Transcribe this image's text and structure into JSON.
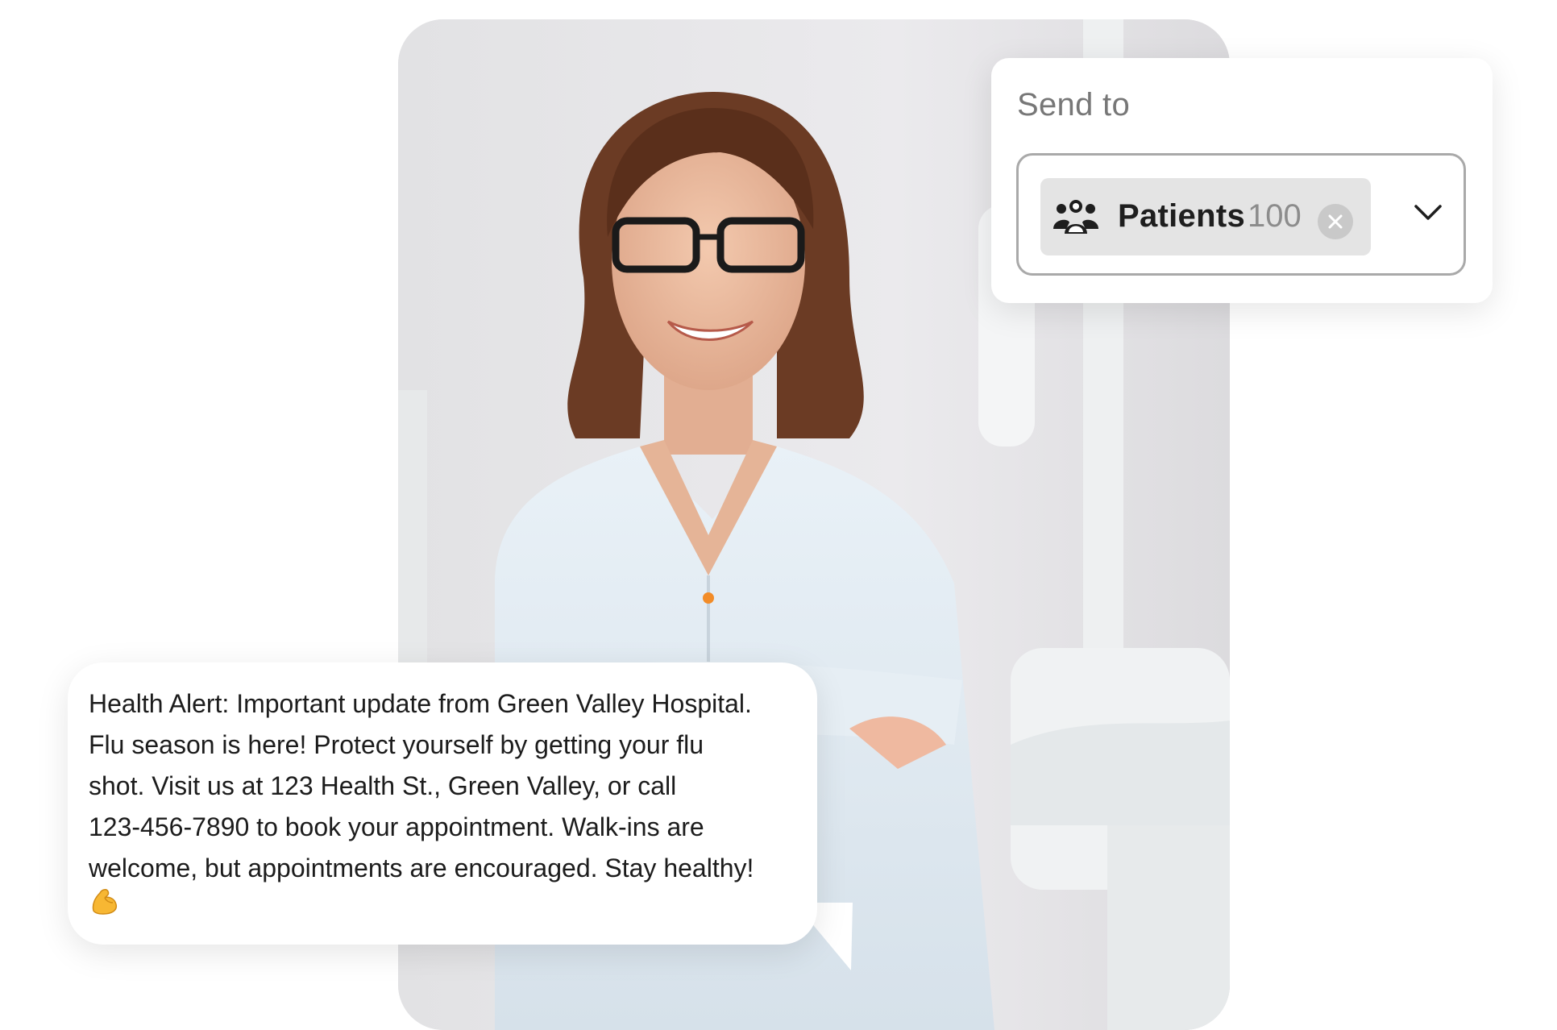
{
  "send_to": {
    "title": "Send to",
    "chip_label": "Patients",
    "chip_count": "100"
  },
  "message": {
    "text": "Health Alert: Important update from Green Valley Hospital.\nFlu season is here! Protect yourself by getting your flu\nshot. Visit us at 123 Health St., Green Valley, or call\n123-456-7890 to book your appointment. Walk-ins are\nwelcome, but appointments are encouraged. Stay healthy!",
    "emoji": "flexed-biceps-icon"
  },
  "icons": {
    "chip": "users-group-icon",
    "clear": "close-icon",
    "dropdown": "chevron-down-icon"
  },
  "colors": {
    "chip_bg": "#e4e4e4",
    "border": "#a9a9a9",
    "muted_text": "#8c8c8c"
  }
}
